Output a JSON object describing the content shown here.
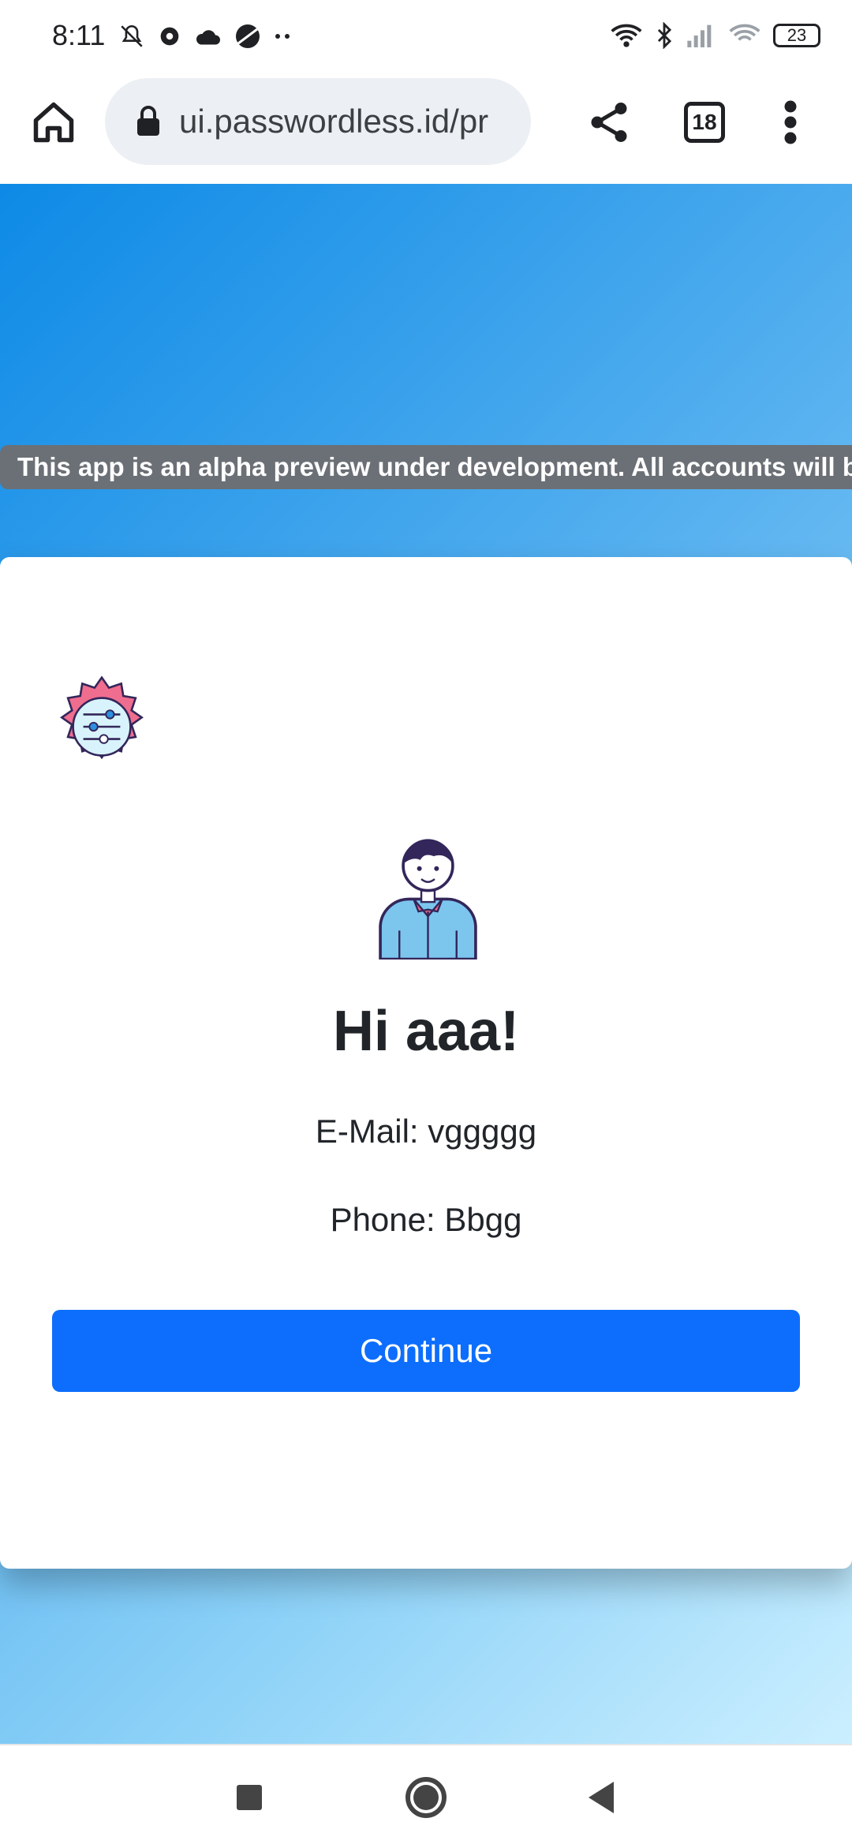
{
  "status": {
    "time": "8:11",
    "left_icons": [
      "mute-icon",
      "gear-icon",
      "cloud-icon",
      "planet-icon",
      "more-dots-icon"
    ],
    "right_icons": [
      "wifi-icon",
      "bluetooth-icon",
      "signal-icon",
      "wifi-calling-icon"
    ],
    "battery": "23"
  },
  "browser": {
    "url": "ui.passwordless.id/pr",
    "tab_count": "18",
    "icons": [
      "home-icon",
      "lock-icon",
      "share-icon",
      "tabs-icon",
      "menu-icon"
    ]
  },
  "banner": {
    "text": "This app is an alpha preview under development. All accounts will be de"
  },
  "card": {
    "title": "Hi aaa!",
    "email": "E-Mail: vggggg",
    "phone": "Phone: Bbgg",
    "continue_label": "Continue"
  },
  "colors": {
    "primary": "#0d6efd",
    "banner_bg": "#6b7076",
    "gradient_start": "#0d8ae6",
    "gradient_end": "#cbefff"
  },
  "nav": {
    "icons": [
      "recents-icon",
      "home-circle-icon",
      "back-icon"
    ]
  }
}
